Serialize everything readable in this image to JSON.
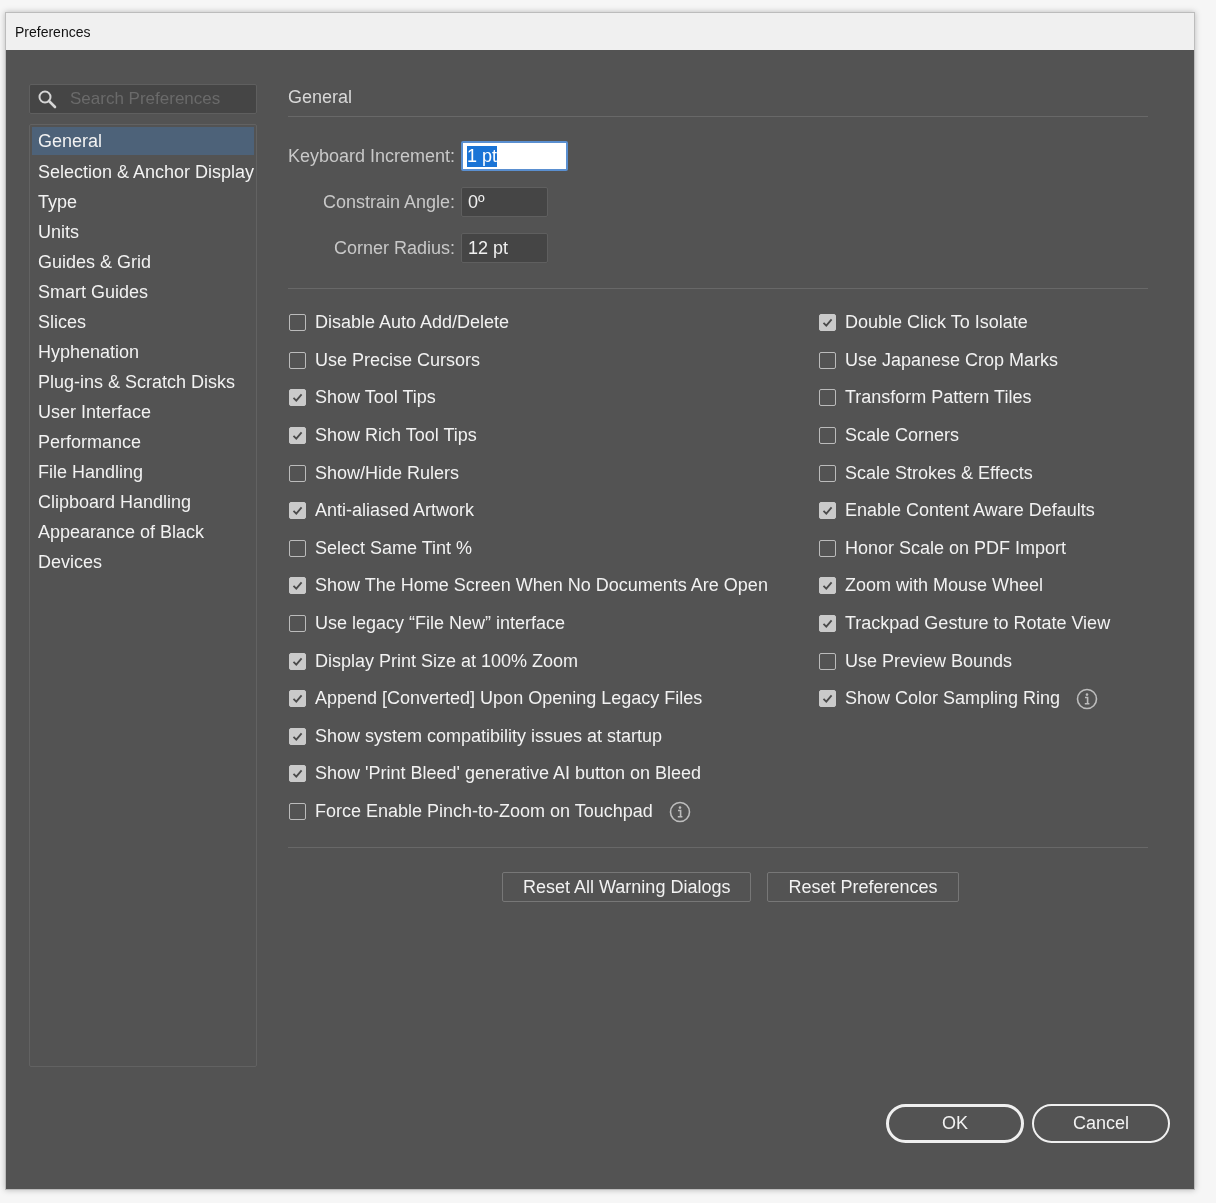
{
  "window": {
    "title": "Preferences"
  },
  "search": {
    "placeholder": "Search Preferences"
  },
  "sidebar": {
    "items": [
      {
        "label": "General",
        "selected": true
      },
      {
        "label": "Selection & Anchor Display",
        "selected": false
      },
      {
        "label": "Type",
        "selected": false
      },
      {
        "label": "Units",
        "selected": false
      },
      {
        "label": "Guides & Grid",
        "selected": false
      },
      {
        "label": "Smart Guides",
        "selected": false
      },
      {
        "label": "Slices",
        "selected": false
      },
      {
        "label": "Hyphenation",
        "selected": false
      },
      {
        "label": "Plug-ins & Scratch Disks",
        "selected": false
      },
      {
        "label": "User Interface",
        "selected": false
      },
      {
        "label": "Performance",
        "selected": false
      },
      {
        "label": "File Handling",
        "selected": false
      },
      {
        "label": "Clipboard Handling",
        "selected": false
      },
      {
        "label": "Appearance of Black",
        "selected": false
      },
      {
        "label": "Devices",
        "selected": false
      }
    ]
  },
  "section": {
    "title": "General"
  },
  "fields": [
    {
      "label": "Keyboard Increment:",
      "value": "1 pt",
      "focused": true
    },
    {
      "label": "Constrain Angle:",
      "value": "0º",
      "focused": false
    },
    {
      "label": "Corner Radius:",
      "value": "12 pt",
      "focused": false
    }
  ],
  "options": {
    "left": [
      {
        "label": "Disable Auto Add/Delete",
        "checked": false,
        "info": false
      },
      {
        "label": "Use Precise Cursors",
        "checked": false,
        "info": false
      },
      {
        "label": "Show Tool Tips",
        "checked": true,
        "info": false
      },
      {
        "label": "Show Rich Tool Tips",
        "checked": true,
        "info": false
      },
      {
        "label": "Show/Hide Rulers",
        "checked": false,
        "info": false
      },
      {
        "label": "Anti-aliased Artwork",
        "checked": true,
        "info": false
      },
      {
        "label": "Select Same Tint %",
        "checked": false,
        "info": false
      },
      {
        "label": "Show The Home Screen When No Documents Are Open",
        "checked": true,
        "info": false
      },
      {
        "label": "Use legacy “File New” interface",
        "checked": false,
        "info": false
      },
      {
        "label": "Display Print Size at 100% Zoom",
        "checked": true,
        "info": false
      },
      {
        "label": "Append [Converted] Upon Opening Legacy Files",
        "checked": true,
        "info": false
      },
      {
        "label": "Show system compatibility issues at startup",
        "checked": true,
        "info": false
      },
      {
        "label": "Show 'Print Bleed' generative AI button on Bleed",
        "checked": true,
        "info": false
      },
      {
        "label": "Force Enable Pinch-to-Zoom on Touchpad",
        "checked": false,
        "info": true
      }
    ],
    "right": [
      {
        "label": "Double Click To Isolate",
        "checked": true,
        "info": false
      },
      {
        "label": "Use Japanese Crop Marks",
        "checked": false,
        "info": false
      },
      {
        "label": "Transform Pattern Tiles",
        "checked": false,
        "info": false
      },
      {
        "label": "Scale Corners",
        "checked": false,
        "info": false
      },
      {
        "label": "Scale Strokes & Effects",
        "checked": false,
        "info": false
      },
      {
        "label": "Enable Content Aware Defaults",
        "checked": true,
        "info": false
      },
      {
        "label": "Honor Scale on PDF Import",
        "checked": false,
        "info": false
      },
      {
        "label": "Zoom with Mouse Wheel",
        "checked": true,
        "info": false
      },
      {
        "label": "Trackpad Gesture to Rotate View",
        "checked": true,
        "info": false
      },
      {
        "label": "Use Preview Bounds",
        "checked": false,
        "info": false
      },
      {
        "label": "Show Color Sampling Ring",
        "checked": true,
        "info": true
      }
    ]
  },
  "reset_buttons": [
    "Reset All Warning Dialogs",
    "Reset Preferences"
  ],
  "footer_buttons": [
    {
      "label": "OK",
      "default": true
    },
    {
      "label": "Cancel",
      "default": false
    }
  ]
}
